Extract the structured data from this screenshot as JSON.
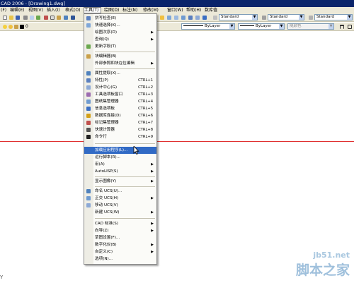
{
  "window": {
    "title": "CAD 2006 - [Drawing1.dwg]"
  },
  "menubar": {
    "items": [
      {
        "label": "(F)"
      },
      {
        "label": "编辑(E)"
      },
      {
        "label": "视图(V)"
      },
      {
        "label": "插入(I)"
      },
      {
        "label": "格式(O)"
      },
      {
        "label": "工具(T)"
      },
      {
        "label": "绘图(D)"
      },
      {
        "label": "标注(N)"
      },
      {
        "label": "修改(M)"
      },
      {
        "label": "窗口(W)"
      },
      {
        "label": "帮助(H)"
      },
      {
        "label": "数库值"
      }
    ],
    "active_index": 5
  },
  "toolbar1": {
    "text_style": "Standard",
    "dim_style": "Standard",
    "table_style": "Standard"
  },
  "toolbar2": {
    "layer": "0",
    "linetype": "ByLayer",
    "lineweight": "ByLayer",
    "plotstyle": "随颜色"
  },
  "tools_menu": {
    "items": [
      {
        "label": "拼写检查(E)",
        "icon": "spell-check-icon"
      },
      {
        "label": "快速选择(K)...",
        "icon": "quick-select-icon"
      },
      {
        "label": "绘图次序(D)",
        "submenu": true
      },
      {
        "label": "查询(Q)",
        "submenu": true
      },
      {
        "label": "更新字段(T)",
        "icon": "update-field-icon"
      },
      {
        "label": "块编辑器(B)",
        "icon": "block-editor-icon"
      },
      {
        "label": "外部参照和块在位编辑",
        "submenu": true
      },
      {
        "label": "属性提取(X)...",
        "icon": "attribute-extract-icon"
      },
      {
        "label": "特性(P)",
        "shortcut": "CTRL+1",
        "icon": "properties-icon"
      },
      {
        "label": "设计中心(G)",
        "shortcut": "CTRL+2",
        "icon": "design-center-icon"
      },
      {
        "label": "工具选项板窗口",
        "shortcut": "CTRL+3",
        "icon": "tool-palette-icon"
      },
      {
        "label": "图纸集管理器",
        "shortcut": "CTRL+4",
        "icon": "sheet-set-icon"
      },
      {
        "label": "信息选项板",
        "shortcut": "CTRL+5",
        "icon": "info-palette-icon"
      },
      {
        "label": "数据库连接(D)",
        "shortcut": "CTRL+6",
        "icon": "database-icon"
      },
      {
        "label": "标记集管理器",
        "shortcut": "CTRL+7",
        "icon": "markup-set-icon"
      },
      {
        "label": "快速计算器",
        "shortcut": "CTRL+8",
        "icon": "calculator-icon"
      },
      {
        "label": "命令行",
        "shortcut": "CTRL+9",
        "icon": "command-line-icon"
      },
      {
        "label": "加载应用程序(L)...",
        "highlighted": true
      },
      {
        "label": "运行脚本(R)..."
      },
      {
        "label": "宏(A)",
        "submenu": true
      },
      {
        "label": "AutoLISP(S)",
        "submenu": true
      },
      {
        "label": "显示图像(Y)",
        "submenu": true
      },
      {
        "label": "命名 UCS(U)...",
        "icon": "named-ucs-icon"
      },
      {
        "label": "正交 UCS(H)",
        "submenu": true,
        "icon": "ortho-ucs-icon"
      },
      {
        "label": "移动 UCS(V)",
        "icon": "move-ucs-icon"
      },
      {
        "label": "新建 UCS(W)",
        "submenu": true
      },
      {
        "label": "CAD 标准(S)",
        "submenu": true
      },
      {
        "label": "向导(Z)",
        "submenu": true
      },
      {
        "label": "草图设置(F)..."
      },
      {
        "label": "数字化仪(B)",
        "submenu": true
      },
      {
        "label": "自定义(C)",
        "submenu": true
      },
      {
        "label": "选项(N)..."
      }
    ]
  },
  "watermark": {
    "url": "jb51.net",
    "brand": "脚本之家"
  },
  "colors": {
    "highlight": "#316ac5",
    "crosshair": "#e03030",
    "titlebar": "#0a246a"
  }
}
